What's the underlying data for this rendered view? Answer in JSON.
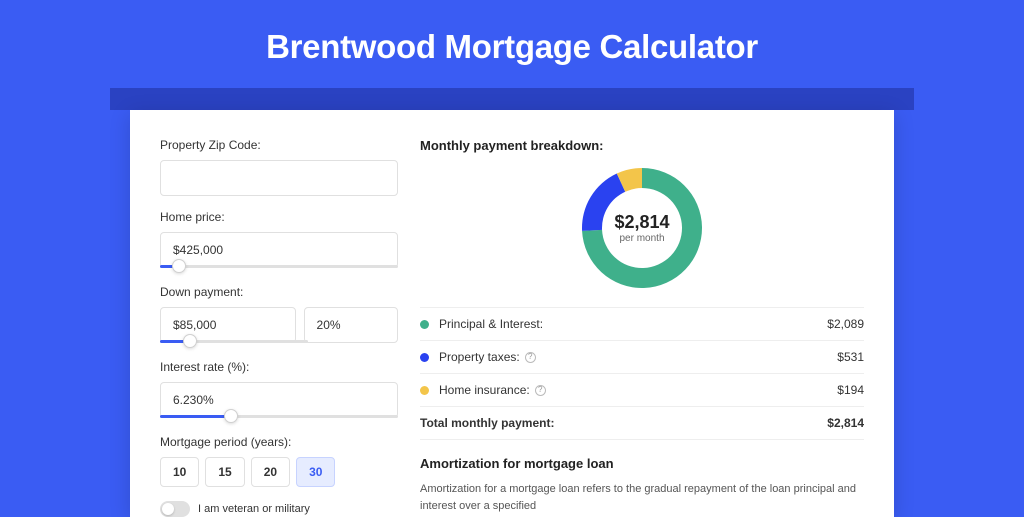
{
  "page_title": "Brentwood Mortgage Calculator",
  "form": {
    "zip_label": "Property Zip Code:",
    "zip_value": "",
    "home_price_label": "Home price:",
    "home_price_value": "$425,000",
    "down_payment_label": "Down payment:",
    "down_payment_value": "$85,000",
    "down_payment_pct": "20%",
    "interest_label": "Interest rate (%):",
    "interest_value": "6.230%",
    "period_label": "Mortgage period (years):",
    "period_options": [
      "10",
      "15",
      "20",
      "30"
    ],
    "period_selected": "30",
    "veteran_label": "I am veteran or military"
  },
  "breakdown": {
    "title": "Monthly payment breakdown:",
    "donut_amount": "$2,814",
    "donut_sub": "per month",
    "items": [
      {
        "label": "Principal & Interest:",
        "value": "$2,089",
        "color": "#3fb08b",
        "info": false
      },
      {
        "label": "Property taxes:",
        "value": "$531",
        "color": "#2a42f0",
        "info": true
      },
      {
        "label": "Home insurance:",
        "value": "$194",
        "color": "#f3c54a",
        "info": true
      }
    ],
    "total_label": "Total monthly payment:",
    "total_value": "$2,814"
  },
  "chart_data": {
    "type": "pie",
    "title": "Monthly payment breakdown",
    "series": [
      {
        "name": "Principal & Interest",
        "value": 2089,
        "color": "#3fb08b"
      },
      {
        "name": "Property taxes",
        "value": 531,
        "color": "#2a42f0"
      },
      {
        "name": "Home insurance",
        "value": 194,
        "color": "#f3c54a"
      }
    ],
    "total": 2814,
    "center_label": "$2,814 per month"
  },
  "amortization": {
    "title": "Amortization for mortgage loan",
    "text": "Amortization for a mortgage loan refers to the gradual repayment of the loan principal and interest over a specified"
  },
  "sliders": {
    "home_price_pct": 8,
    "down_payment_pct": 20,
    "interest_pct": 30
  }
}
